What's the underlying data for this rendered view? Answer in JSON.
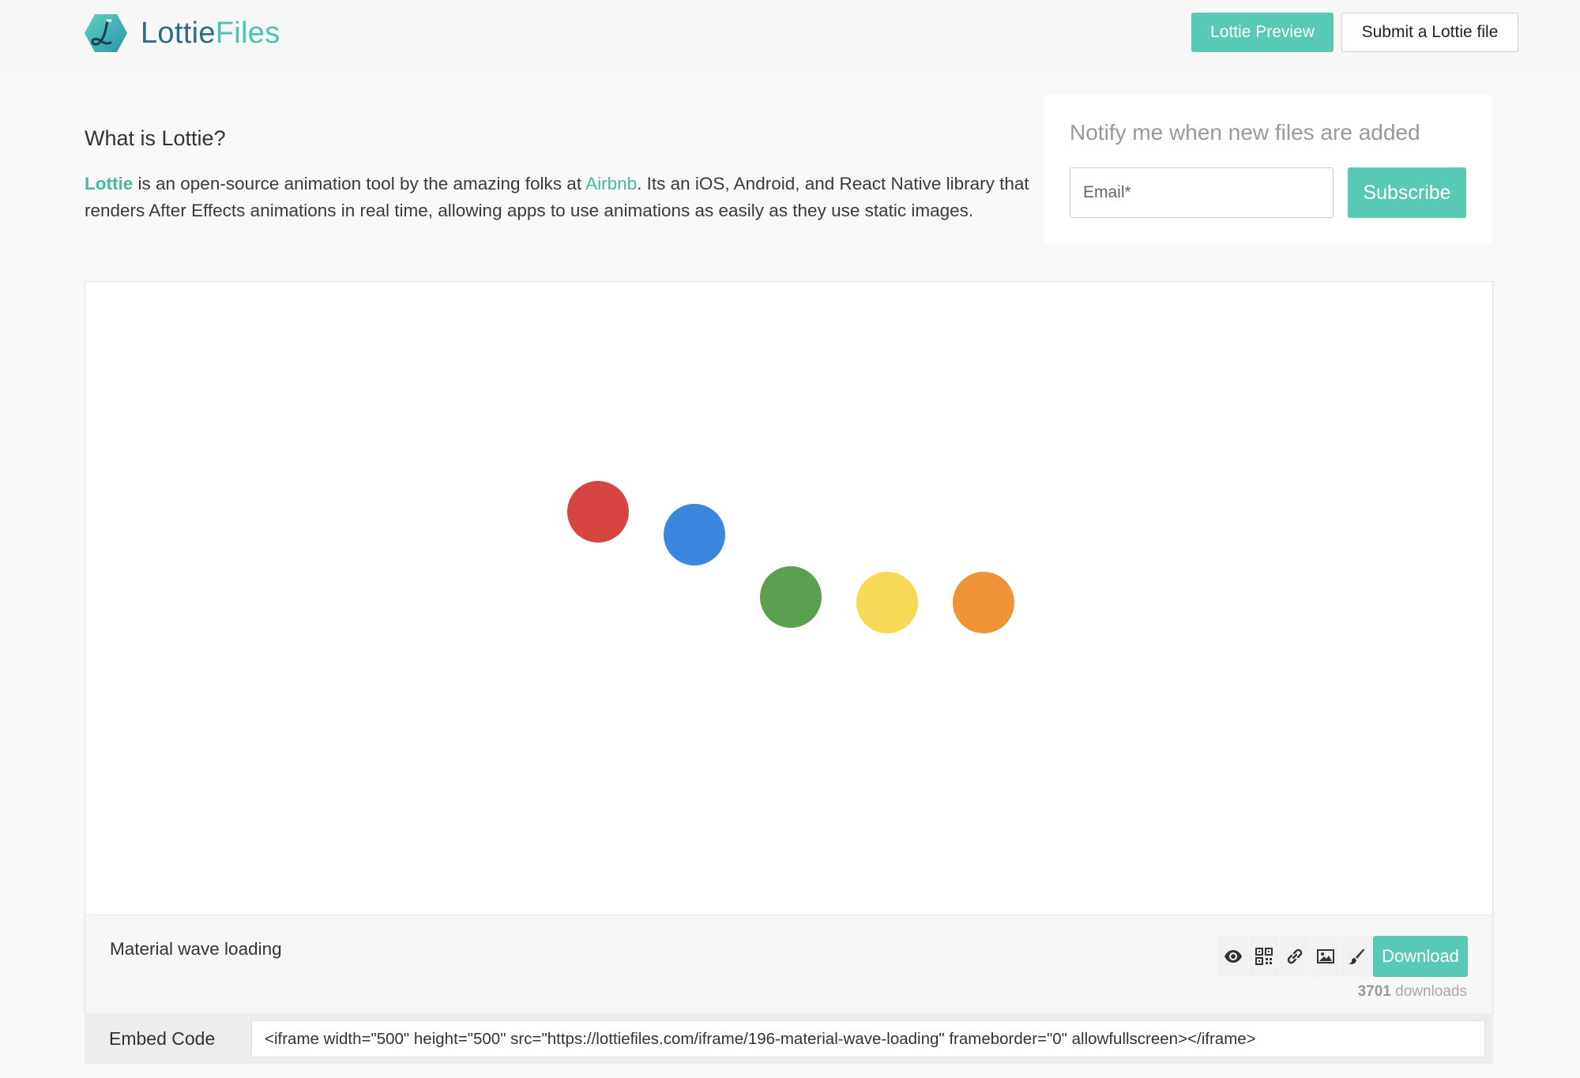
{
  "header": {
    "brand_part1": "Lottie",
    "brand_part2": "Files",
    "preview_button": "Lottie Preview",
    "submit_button": "Submit a Lottie file"
  },
  "intro": {
    "title": "What is Lottie?",
    "lottie_link": "Lottie",
    "text_1": " is an open-source animation tool by the amazing folks at ",
    "airbnb_link": "Airbnb",
    "text_2": ". Its an iOS, Android, and React Native library that renders After Effects animations in real time, allowing apps to use animations as easily as they use static images."
  },
  "notify": {
    "title": "Notify me when new files are added",
    "email_placeholder": "Email*",
    "subscribe_button": "Subscribe"
  },
  "animation": {
    "name": "Material wave loading",
    "dot_colors": [
      "#d64541",
      "#3b86df",
      "#5ba04f",
      "#f8d856",
      "#ee9436"
    ],
    "tools": [
      {
        "name": "preview-eye-icon"
      },
      {
        "name": "qr-code-icon"
      },
      {
        "name": "link-icon"
      },
      {
        "name": "image-icon"
      },
      {
        "name": "brush-icon"
      }
    ],
    "download_button": "Download",
    "download_count": "3701",
    "download_suffix": " downloads"
  },
  "embed": {
    "label": "Embed Code",
    "code": "<iframe width=\"500\" height=\"500\" src=\"https://lottiefiles.com/iframe/196-material-wave-loading\" frameborder=\"0\" allowfullscreen></iframe>"
  },
  "colors": {
    "accent": "#58c9b4",
    "brand_dark": "#2f6b82"
  }
}
